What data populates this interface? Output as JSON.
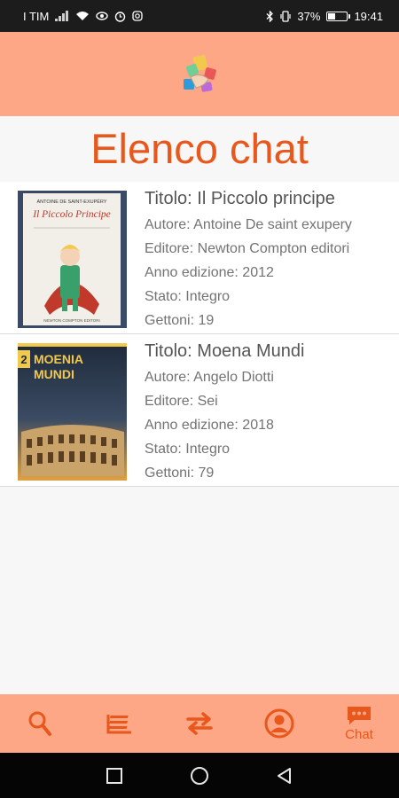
{
  "status_bar": {
    "carrier": "I TIM",
    "battery_percent": "37%",
    "time": "19:41",
    "battery_level": 0.37
  },
  "header": {
    "logo_icon": "book-swap-logo-icon"
  },
  "page": {
    "title": "Elenco chat"
  },
  "chats": [
    {
      "title": "Titolo: Il Piccolo principe",
      "author": "Autore: Antoine De saint exupery",
      "publisher": "Editore: Newton Compton editori",
      "year": "Anno edizione: 2012",
      "state": "Stato: Integro",
      "tokens": "Gettoni: 19",
      "cover": {
        "top_text": "ANTOINE DE SAINT-EXUPÉRY",
        "title_text": "Il Piccolo Principe",
        "bottom_text": "NEWTON COMPTON EDITORI"
      }
    },
    {
      "title": "Titolo: Moena Mundi",
      "author": "Autore: Angelo Diotti",
      "publisher": "Editore: Sei",
      "year": "Anno edizione: 2018",
      "state": "Stato: Integro",
      "tokens": "Gettoni: 79",
      "cover": {
        "volume": "2",
        "title_line1": "MOENIA",
        "title_line2": "MUNDI"
      }
    }
  ],
  "bottom_nav": {
    "items": [
      {
        "icon": "search-icon"
      },
      {
        "icon": "books-icon"
      },
      {
        "icon": "exchange-icon"
      },
      {
        "icon": "profile-icon"
      },
      {
        "icon": "chat-icon",
        "label": "Chat"
      }
    ],
    "accent": "#e8571b",
    "background": "#fda786"
  },
  "colors": {
    "title": "#e8571b",
    "header_bg": "#fda786"
  }
}
